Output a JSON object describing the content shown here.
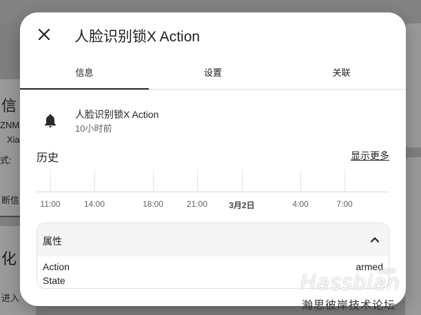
{
  "background": {
    "texts": [
      "信",
      "ZNM",
      "Xia",
      "式:",
      "断信",
      "化",
      "进入"
    ]
  },
  "dialog": {
    "title": "人脸识别锁X Action",
    "close_icon": "close-icon",
    "tabs": [
      {
        "label": "信息",
        "active": true
      },
      {
        "label": "设置",
        "active": false
      },
      {
        "label": "关联",
        "active": false
      }
    ],
    "entity": {
      "icon": "bell-icon",
      "name": "人脸识别锁X Action",
      "last_changed": "10小时前"
    },
    "history": {
      "title": "历史",
      "show_more": "显示更多",
      "ticks": [
        {
          "label": "11:00",
          "bold": false
        },
        {
          "label": "14:00",
          "bold": false
        },
        {
          "label": "18:00",
          "bold": false
        },
        {
          "label": "21:00",
          "bold": false
        },
        {
          "label": "3月2日",
          "bold": true
        },
        {
          "label": "4:00",
          "bold": false
        },
        {
          "label": "7:00",
          "bold": false
        }
      ]
    },
    "attributes": {
      "title": "属性",
      "expanded": true,
      "rows": [
        {
          "key": "Action",
          "value": "armed"
        },
        {
          "key": "State",
          "value": ""
        }
      ]
    }
  },
  "watermark": {
    "main": "Hassbian",
    "com": "com",
    "sub": "瀚思彼岸技术论坛"
  },
  "colors": {
    "scrim": "#7f7f7f",
    "dialog_bg": "#ffffff",
    "accent": "#212121"
  }
}
